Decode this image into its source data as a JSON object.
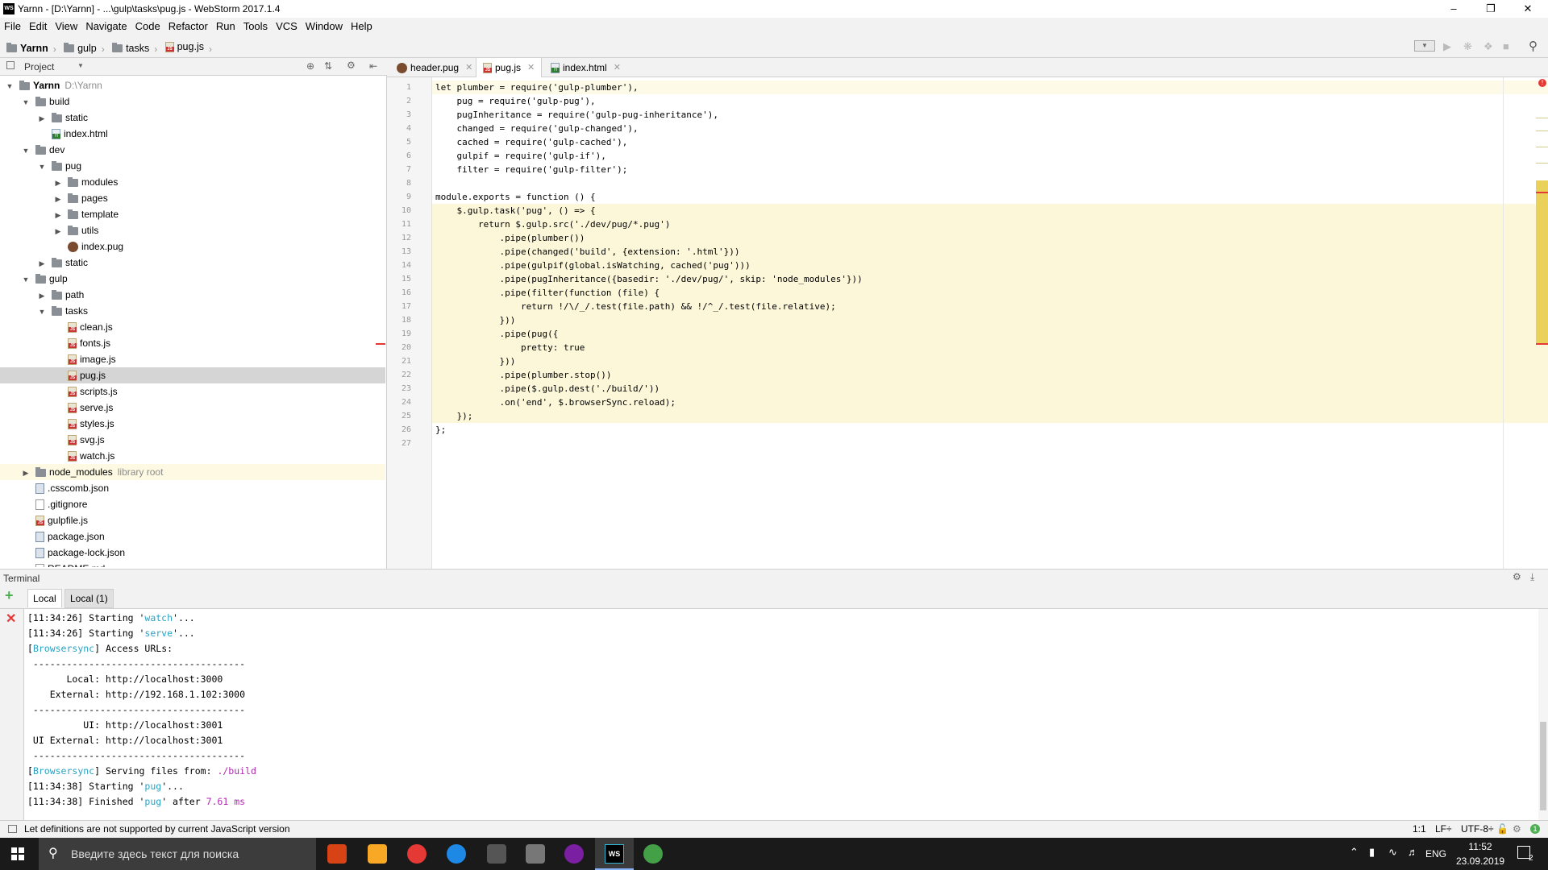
{
  "window": {
    "title": "Yarnn - [D:\\Yarnn] - ...\\gulp\\tasks\\pug.js - WebStorm 2017.1.4",
    "app_logo": "WS"
  },
  "menu": [
    "File",
    "Edit",
    "View",
    "Navigate",
    "Code",
    "Refactor",
    "Run",
    "Tools",
    "VCS",
    "Window",
    "Help"
  ],
  "breadcrumb": [
    "Yarnn",
    "gulp",
    "tasks",
    "pug.js"
  ],
  "project_panel": {
    "title": "Project",
    "tree": [
      {
        "label": "Yarnn",
        "extra": "D:\\Yarnn",
        "indent": 0,
        "arrow": "▼",
        "icon": "folder-icon"
      },
      {
        "label": "build",
        "indent": 1,
        "arrow": "▼",
        "icon": "folder-icon"
      },
      {
        "label": "static",
        "indent": 2,
        "arrow": "▶",
        "icon": "folder-icon"
      },
      {
        "label": "index.html",
        "indent": 2,
        "arrow": "",
        "icon": "html-file-icon"
      },
      {
        "label": "dev",
        "indent": 1,
        "arrow": "▼",
        "icon": "folder-icon"
      },
      {
        "label": "pug",
        "indent": 2,
        "arrow": "▼",
        "icon": "folder-icon"
      },
      {
        "label": "modules",
        "indent": 3,
        "arrow": "▶",
        "icon": "folder-icon"
      },
      {
        "label": "pages",
        "indent": 3,
        "arrow": "▶",
        "icon": "folder-icon"
      },
      {
        "label": "template",
        "indent": 3,
        "arrow": "▶",
        "icon": "folder-icon"
      },
      {
        "label": "utils",
        "indent": 3,
        "arrow": "▶",
        "icon": "folder-icon"
      },
      {
        "label": "index.pug",
        "indent": 3,
        "arrow": "",
        "icon": "pug-file-icon"
      },
      {
        "label": "static",
        "indent": 2,
        "arrow": "▶",
        "icon": "folder-icon"
      },
      {
        "label": "gulp",
        "indent": 1,
        "arrow": "▼",
        "icon": "folder-icon"
      },
      {
        "label": "path",
        "indent": 2,
        "arrow": "▶",
        "icon": "folder-icon"
      },
      {
        "label": "tasks",
        "indent": 2,
        "arrow": "▼",
        "icon": "folder-icon"
      },
      {
        "label": "clean.js",
        "indent": 3,
        "arrow": "",
        "icon": "js-file-icon"
      },
      {
        "label": "fonts.js",
        "indent": 3,
        "arrow": "",
        "icon": "js-file-icon"
      },
      {
        "label": "image.js",
        "indent": 3,
        "arrow": "",
        "icon": "js-file-icon"
      },
      {
        "label": "pug.js",
        "indent": 3,
        "arrow": "",
        "icon": "js-file-icon",
        "selected": true
      },
      {
        "label": "scripts.js",
        "indent": 3,
        "arrow": "",
        "icon": "js-file-icon"
      },
      {
        "label": "serve.js",
        "indent": 3,
        "arrow": "",
        "icon": "js-file-icon"
      },
      {
        "label": "styles.js",
        "indent": 3,
        "arrow": "",
        "icon": "js-file-icon"
      },
      {
        "label": "svg.js",
        "indent": 3,
        "arrow": "",
        "icon": "js-file-icon"
      },
      {
        "label": "watch.js",
        "indent": 3,
        "arrow": "",
        "icon": "js-file-icon"
      },
      {
        "label": "node_modules",
        "extra": "library root",
        "indent": 1,
        "arrow": "▶",
        "icon": "folder-icon",
        "library": true
      },
      {
        "label": ".csscomb.json",
        "indent": 1,
        "arrow": "",
        "icon": "json-file-icon"
      },
      {
        "label": ".gitignore",
        "indent": 1,
        "arrow": "",
        "icon": "text-file-icon"
      },
      {
        "label": "gulpfile.js",
        "indent": 1,
        "arrow": "",
        "icon": "js-file-icon"
      },
      {
        "label": "package.json",
        "indent": 1,
        "arrow": "",
        "icon": "json-file-icon"
      },
      {
        "label": "package-lock.json",
        "indent": 1,
        "arrow": "",
        "icon": "json-file-icon"
      },
      {
        "label": "README.md",
        "indent": 1,
        "arrow": "",
        "icon": "text-file-icon"
      }
    ]
  },
  "editor": {
    "tabs": [
      {
        "label": "header.pug",
        "icon": "pug-file-icon",
        "active": false
      },
      {
        "label": "pug.js",
        "icon": "js-file-icon",
        "active": true
      },
      {
        "label": "index.html",
        "icon": "html-file-icon",
        "active": false
      }
    ],
    "lines": [
      "let plumber = require('gulp-plumber'),",
      "    pug = require('gulp-pug'),",
      "    pugInheritance = require('gulp-pug-inheritance'),",
      "    changed = require('gulp-changed'),",
      "    cached = require('gulp-cached'),",
      "    gulpif = require('gulp-if'),",
      "    filter = require('gulp-filter');",
      "",
      "module.exports = function () {",
      "    $.gulp.task('pug', () => {",
      "        return $.gulp.src('./dev/pug/*.pug')",
      "            .pipe(plumber())",
      "            .pipe(changed('build', {extension: '.html'}))",
      "            .pipe(gulpif(global.isWatching, cached('pug')))",
      "            .pipe(pugInheritance({basedir: './dev/pug/', skip: 'node_modules'}))",
      "            .pipe(filter(function (file) {",
      "                return !/\\/_/.test(file.path) && !/^_/.test(file.relative);",
      "            }))",
      "            .pipe(pug({",
      "                pretty: true",
      "            }))",
      "            .pipe(plumber.stop())",
      "            .pipe($.gulp.dest('./build/'))",
      "            .on('end', $.browserSync.reload);",
      "    });",
      "};",
      ""
    ],
    "highlighted_from": 10,
    "highlighted_to": 25
  },
  "terminal": {
    "title": "Terminal",
    "tabs": [
      "Local",
      "Local (1)"
    ],
    "lines": [
      [
        {
          "t": "[11:34:26] Starting '"
        },
        {
          "t": "watch",
          "c": "cyan"
        },
        {
          "t": "'..."
        }
      ],
      [
        {
          "t": "[11:34:26] Starting '"
        },
        {
          "t": "serve",
          "c": "cyan"
        },
        {
          "t": "'..."
        }
      ],
      [
        {
          "t": "[",
          "c": ""
        },
        {
          "t": "Browsersync",
          "c": "cyan"
        },
        {
          "t": "] Access URLs:"
        }
      ],
      [
        {
          "t": " --------------------------------------"
        }
      ],
      [
        {
          "t": "       Local: http://localhost:3000"
        }
      ],
      [
        {
          "t": "    External: http://192.168.1.102:3000"
        }
      ],
      [
        {
          "t": " --------------------------------------"
        }
      ],
      [
        {
          "t": "          UI: http://localhost:3001"
        }
      ],
      [
        {
          "t": " UI External: http://localhost:3001"
        }
      ],
      [
        {
          "t": " --------------------------------------"
        }
      ],
      [
        {
          "t": "["
        },
        {
          "t": "Browsersync",
          "c": "cyan"
        },
        {
          "t": "] Serving files from: "
        },
        {
          "t": "./build",
          "c": "magenta"
        }
      ],
      [
        {
          "t": "[11:34:38] Starting '"
        },
        {
          "t": "pug",
          "c": "cyan"
        },
        {
          "t": "'..."
        }
      ],
      [
        {
          "t": "[11:34:38] Finished '"
        },
        {
          "t": "pug",
          "c": "cyan"
        },
        {
          "t": "' after "
        },
        {
          "t": "7.61 ms",
          "c": "magenta"
        }
      ]
    ]
  },
  "statusbar": {
    "message": "Let definitions are not supported by current JavaScript version",
    "position": "1:1",
    "line_sep": "LF÷",
    "encoding": "UTF-8÷"
  },
  "taskbar": {
    "search_placeholder": "Введите здесь текст для поиска",
    "lang": "ENG",
    "time": "11:52",
    "date": "23.09.2019",
    "notifications": "2"
  },
  "colors": {
    "accent_green": "#4caf50",
    "error_red": "#e53935",
    "highlight_yellow": "#fcf7d9"
  }
}
